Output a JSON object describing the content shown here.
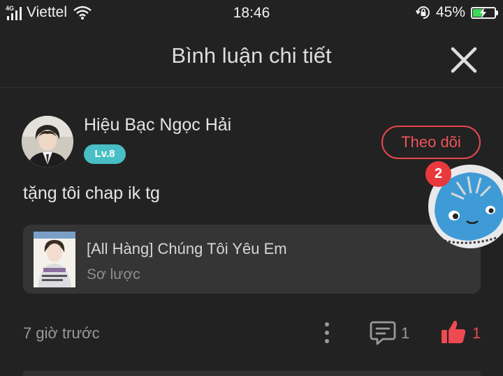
{
  "status_bar": {
    "network_type": "4G",
    "carrier": "Viettel",
    "time": "18:46",
    "battery_percent": "45%",
    "battery_level": 0.45,
    "icons": [
      "signal-icon",
      "wifi-icon",
      "rotation-lock-icon",
      "battery-charging-icon"
    ]
  },
  "header": {
    "title": "Bình luận chi tiết",
    "close_icon": "close-icon"
  },
  "comment": {
    "author": {
      "name": "Hiệu Bạc Ngọc Hải",
      "level": "Lv.8"
    },
    "follow_label": "Theo dõi",
    "text": "tặng tôi chap ik tg",
    "story": {
      "title": "[All Hàng] Chúng Tôi Yêu Em",
      "subtitle": "Sơ lược"
    },
    "posted_time": "7 giờ trước",
    "reply_count": "1",
    "like_count": "1"
  },
  "floating_widget": {
    "badge_count": "2"
  },
  "colors": {
    "background": "#222222",
    "accent_red": "#ef4a52",
    "level_badge": "#47bfc4",
    "card": "#353535"
  }
}
